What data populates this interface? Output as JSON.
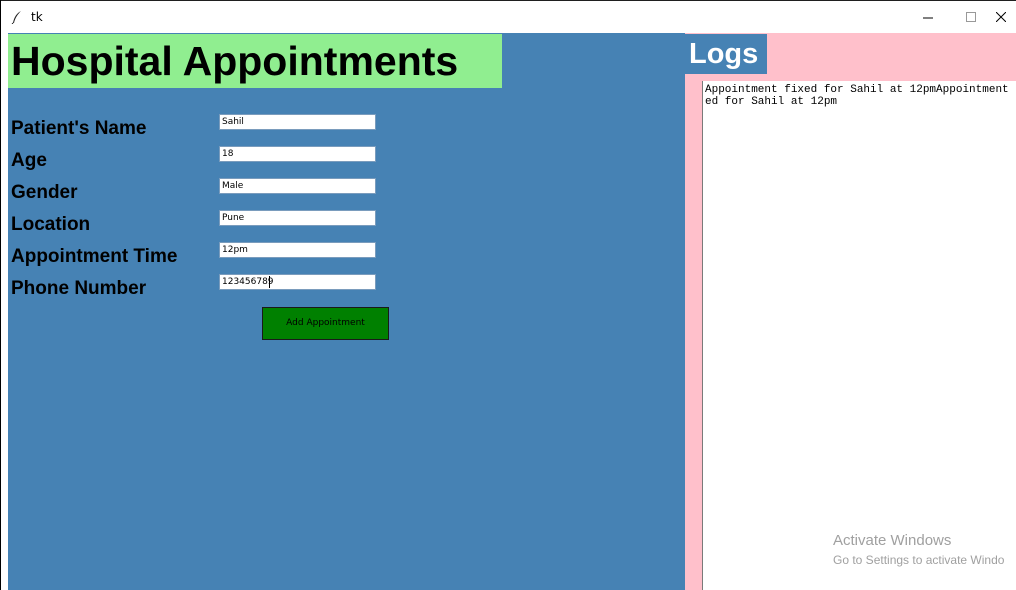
{
  "window": {
    "title": "tk",
    "icon": "feather-icon",
    "controls": [
      "minimize-icon",
      "maximize-icon",
      "close-icon"
    ]
  },
  "form": {
    "heading": "Hospital Appointments",
    "fields": [
      {
        "label": "Patient's Name",
        "value": "Sahil"
      },
      {
        "label": "Age",
        "value": "18"
      },
      {
        "label": "Gender",
        "value": "Male"
      },
      {
        "label": "Location",
        "value": "Pune"
      },
      {
        "label": "Appointment Time",
        "value": "12pm"
      },
      {
        "label": "Phone Number",
        "value": "123456789"
      }
    ],
    "submit_label": "Add Appointment"
  },
  "logs": {
    "heading": "Logs",
    "lines": [
      "Appointment fixed for Sahil at 12pmAppointment",
      "ed for Sahil at 12pm"
    ]
  },
  "watermark": {
    "line1": "Activate Windows",
    "line2": "Go to Settings to activate Windo"
  },
  "colors": {
    "form_background": "#4682b4",
    "heading_background": "#90ee90",
    "logs_background": "#ffc0cb",
    "button_background": "#008000"
  }
}
